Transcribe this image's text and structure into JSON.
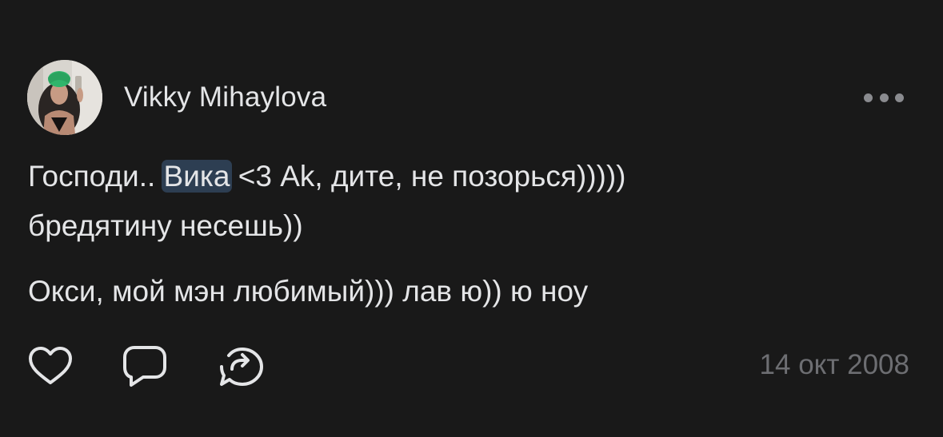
{
  "post": {
    "author": "Vikky Mihaylova",
    "avatar_icon": "user-avatar-photo",
    "more_icon": "more-dots-icon",
    "text": {
      "line1_before": "Господи.. ",
      "mention": "Вика",
      "line1_after": " <3 Ak, дите, не позорься)))))",
      "line2": "бредятину несешь))",
      "line3": "Окси, мой мэн любимый))) лав ю)) ю ноу"
    },
    "actions": {
      "like_icon": "heart-icon",
      "comment_icon": "comment-icon",
      "share_icon": "share-icon"
    },
    "date": "14 окт 2008"
  },
  "colors": {
    "background": "#191919",
    "text": "#e4e5e7",
    "muted": "#6d6e72",
    "mention_bg": "#2d3e52"
  }
}
